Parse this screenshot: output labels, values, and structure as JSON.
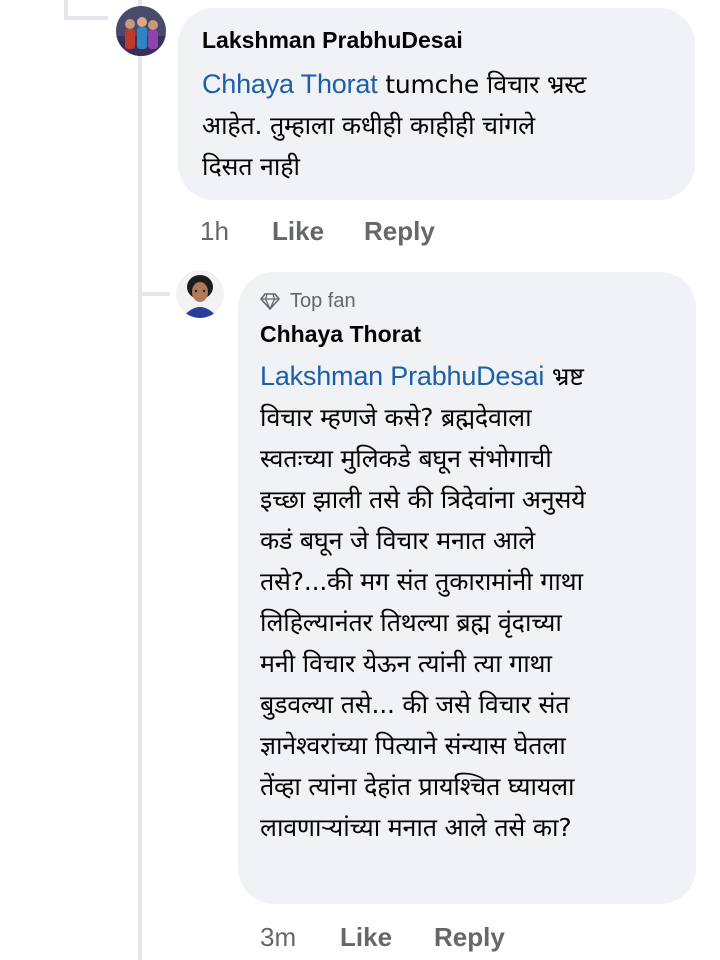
{
  "comments": [
    {
      "author": "Lakshman PrabhuDesai",
      "mention": "Chhaya Thorat",
      "line1": " tumche विचार  भ्रस्ट",
      "line2": "आहेत. तुम्हाला कधीही काहीही चांगले",
      "line3": "दिसत नाही",
      "time": "1h",
      "like_label": "Like",
      "reply_label": "Reply"
    },
    {
      "badge": "Top fan",
      "badge_icon": "diamond-icon",
      "author": "Chhaya Thorat",
      "mention": "Lakshman PrabhuDesai",
      "first_line_rest": " भ्रष्ट",
      "lines": [
        "विचार म्हणजे कसे? ब्रह्मदेवाला",
        "स्वतःच्या मुलिकडे बघून संभोगाची",
        "इच्छा झाली तसे की त्रिदेवांना अनुसये",
        "कडं बघून जे विचार मनात आले",
        "तसे?...की मग संत तुकारामांनी गाथा",
        "लिहिल्यानंतर तिथल्या ब्रह्म वृंदाच्या",
        "मनी विचार येऊन त्यांनी त्या गाथा",
        "बुडवल्या तसे... की जसे विचार संत",
        "ज्ञानेश्वरांच्या पित्याने संन्यास घेतला",
        "तेंव्हा त्यांना देहांत प्रायश्चित घ्यायला",
        "लावणाऱ्यांच्या मनात आले तसे का?"
      ],
      "time": "3m",
      "like_label": "Like",
      "reply_label": "Reply"
    }
  ],
  "colors": {
    "bubble": "#f0f2f5",
    "mention": "#1b5fa8",
    "meta": "#65676b",
    "thread_line": "#e4e6eb"
  }
}
